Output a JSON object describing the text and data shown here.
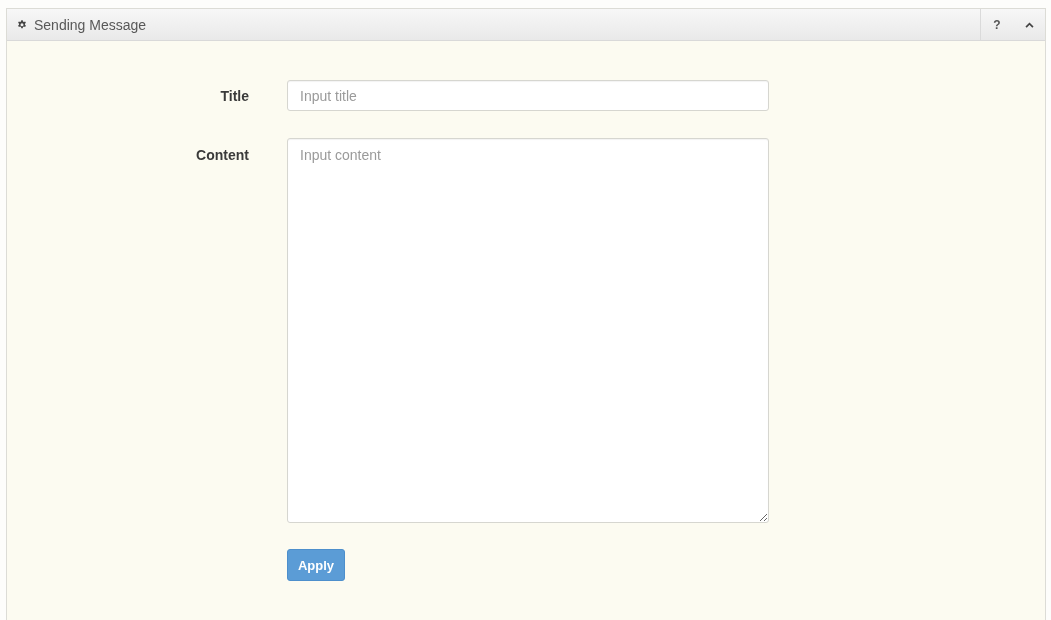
{
  "panel": {
    "title": "Sending Message",
    "actions": [
      {
        "kind": "help",
        "label": "?"
      },
      {
        "kind": "collapse"
      }
    ]
  },
  "form": {
    "fields": [
      {
        "kind": "input",
        "label": "Title",
        "placeholder": "Input title"
      },
      {
        "kind": "textarea",
        "label": "Content",
        "placeholder": "Input content"
      }
    ],
    "submit": "Apply"
  }
}
